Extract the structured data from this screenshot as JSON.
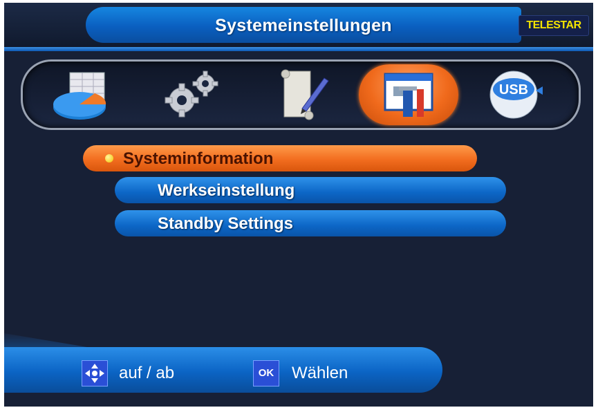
{
  "header": {
    "title": "Systemeinstellungen",
    "brand": "TELESTAR"
  },
  "tabs": [
    {
      "icon": "media-chart-icon",
      "selected": false
    },
    {
      "icon": "gears-icon",
      "selected": false
    },
    {
      "icon": "scroll-pen-icon",
      "selected": false
    },
    {
      "icon": "system-tools-icon",
      "selected": true
    },
    {
      "icon": "usb-disk-icon",
      "selected": false
    }
  ],
  "menu": {
    "items": [
      {
        "label": "Systeminformation",
        "selected": true
      },
      {
        "label": "Werkseinstellung",
        "selected": false
      },
      {
        "label": "Standby Settings",
        "selected": false
      }
    ]
  },
  "footer": {
    "nav_icon": "dpad-icon",
    "nav_label": "auf / ab",
    "ok_icon_text": "OK",
    "ok_label": "Wählen"
  },
  "colors": {
    "background": "#172036",
    "accent_blue": "#0c66c6",
    "selected_orange": "#f26d1f",
    "brand_yellow": "#f4e400"
  }
}
